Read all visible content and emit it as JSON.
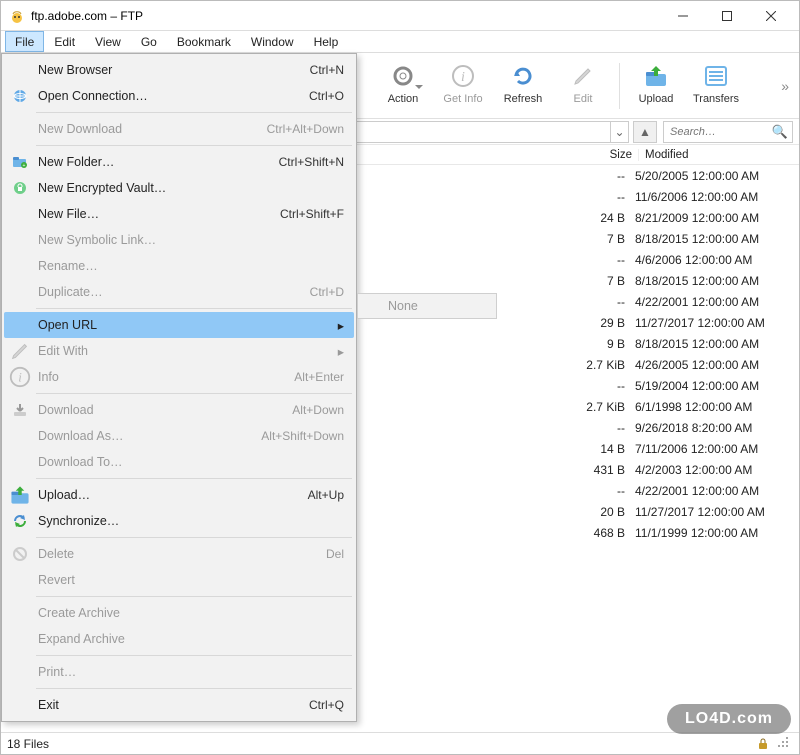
{
  "window": {
    "title": "ftp.adobe.com – FTP"
  },
  "menubar": {
    "items": [
      "File",
      "Edit",
      "View",
      "Go",
      "Bookmark",
      "Window",
      "Help"
    ],
    "open_index": 0
  },
  "toolbar": {
    "buttons": [
      {
        "name": "action",
        "label": "Action",
        "icon": "gear-icon",
        "disabled": false,
        "has_dropdown": true
      },
      {
        "name": "get-info",
        "label": "Get Info",
        "icon": "info-icon",
        "disabled": true
      },
      {
        "name": "refresh",
        "label": "Refresh",
        "icon": "refresh-icon",
        "disabled": false
      },
      {
        "name": "edit",
        "label": "Edit",
        "icon": "pencil-icon",
        "disabled": true
      },
      {
        "name": "upload",
        "label": "Upload",
        "icon": "upload-icon",
        "disabled": false
      },
      {
        "name": "transfers",
        "label": "Transfers",
        "icon": "list-icon",
        "disabled": false
      }
    ]
  },
  "pathbar": {
    "search_placeholder": "Search…"
  },
  "columns": {
    "size": "Size",
    "modified": "Modified"
  },
  "files": [
    {
      "size": "--",
      "modified": "5/20/2005 12:00:00 AM"
    },
    {
      "size": "--",
      "modified": "11/6/2006 12:00:00 AM"
    },
    {
      "size": "24 B",
      "modified": "8/21/2009 12:00:00 AM"
    },
    {
      "size": "7 B",
      "modified": "8/18/2015 12:00:00 AM"
    },
    {
      "size": "--",
      "modified": "4/6/2006 12:00:00 AM"
    },
    {
      "size": "7 B",
      "modified": "8/18/2015 12:00:00 AM"
    },
    {
      "size": "--",
      "modified": "4/22/2001 12:00:00 AM"
    },
    {
      "size": "29 B",
      "modified": "11/27/2017 12:00:00 AM"
    },
    {
      "size": "9 B",
      "modified": "8/18/2015 12:00:00 AM"
    },
    {
      "size": "2.7 KiB",
      "modified": "4/26/2005 12:00:00 AM"
    },
    {
      "size": "--",
      "modified": "5/19/2004 12:00:00 AM"
    },
    {
      "size": "2.7 KiB",
      "modified": "6/1/1998 12:00:00 AM"
    },
    {
      "size": "--",
      "modified": "9/26/2018 8:20:00 AM"
    },
    {
      "size": "14 B",
      "modified": "7/11/2006 12:00:00 AM"
    },
    {
      "size": "431 B",
      "modified": "4/2/2003 12:00:00 AM"
    },
    {
      "size": "--",
      "modified": "4/22/2001 12:00:00 AM"
    },
    {
      "size": "20 B",
      "modified": "11/27/2017 12:00:00 AM"
    },
    {
      "size": "468 B",
      "modified": "11/1/1999 12:00:00 AM"
    }
  ],
  "file_menu": {
    "groups": [
      [
        {
          "label": "New Browser",
          "accel": "Ctrl+N",
          "disabled": false,
          "icon": "blank"
        },
        {
          "label": "Open Connection…",
          "accel": "Ctrl+O",
          "disabled": false,
          "icon": "globe-icon"
        }
      ],
      [
        {
          "label": "New Download",
          "accel": "Ctrl+Alt+Down",
          "disabled": true,
          "icon": "blank"
        }
      ],
      [
        {
          "label": "New Folder…",
          "accel": "Ctrl+Shift+N",
          "disabled": false,
          "icon": "new-folder-icon"
        },
        {
          "label": "New Encrypted Vault…",
          "accel": "",
          "disabled": false,
          "icon": "vault-icon"
        },
        {
          "label": "New File…",
          "accel": "Ctrl+Shift+F",
          "disabled": false,
          "icon": "blank"
        },
        {
          "label": "New Symbolic Link…",
          "accel": "",
          "disabled": true,
          "icon": "blank"
        },
        {
          "label": "Rename…",
          "accel": "",
          "disabled": true,
          "icon": "blank"
        },
        {
          "label": "Duplicate…",
          "accel": "Ctrl+D",
          "disabled": true,
          "icon": "blank"
        }
      ],
      [
        {
          "label": "Open URL",
          "accel": "",
          "disabled": false,
          "icon": "blank",
          "submenu": true,
          "highlighted": true
        },
        {
          "label": "Edit With",
          "accel": "",
          "disabled": true,
          "icon": "pencil-icon",
          "submenu": true
        },
        {
          "label": "Info",
          "accel": "Alt+Enter",
          "disabled": true,
          "icon": "info-icon"
        }
      ],
      [
        {
          "label": "Download",
          "accel": "Alt+Down",
          "disabled": true,
          "icon": "download-icon"
        },
        {
          "label": "Download As…",
          "accel": "Alt+Shift+Down",
          "disabled": true,
          "icon": "blank"
        },
        {
          "label": "Download To…",
          "accel": "",
          "disabled": true,
          "icon": "blank"
        }
      ],
      [
        {
          "label": "Upload…",
          "accel": "Alt+Up",
          "disabled": false,
          "icon": "upload-icon"
        },
        {
          "label": "Synchronize…",
          "accel": "",
          "disabled": false,
          "icon": "sync-icon"
        }
      ],
      [
        {
          "label": "Delete",
          "accel": "Del",
          "disabled": true,
          "icon": "delete-icon"
        },
        {
          "label": "Revert",
          "accel": "",
          "disabled": true,
          "icon": "blank"
        }
      ],
      [
        {
          "label": "Create Archive",
          "accel": "",
          "disabled": true,
          "icon": "blank"
        },
        {
          "label": "Expand Archive",
          "accel": "",
          "disabled": true,
          "icon": "blank"
        }
      ],
      [
        {
          "label": "Print…",
          "accel": "",
          "disabled": true,
          "icon": "blank"
        }
      ],
      [
        {
          "label": "Exit",
          "accel": "Ctrl+Q",
          "disabled": false,
          "icon": "blank"
        }
      ]
    ],
    "submenu_none": "None"
  },
  "status": {
    "text": "18 Files"
  },
  "watermark": "LO4D.com"
}
